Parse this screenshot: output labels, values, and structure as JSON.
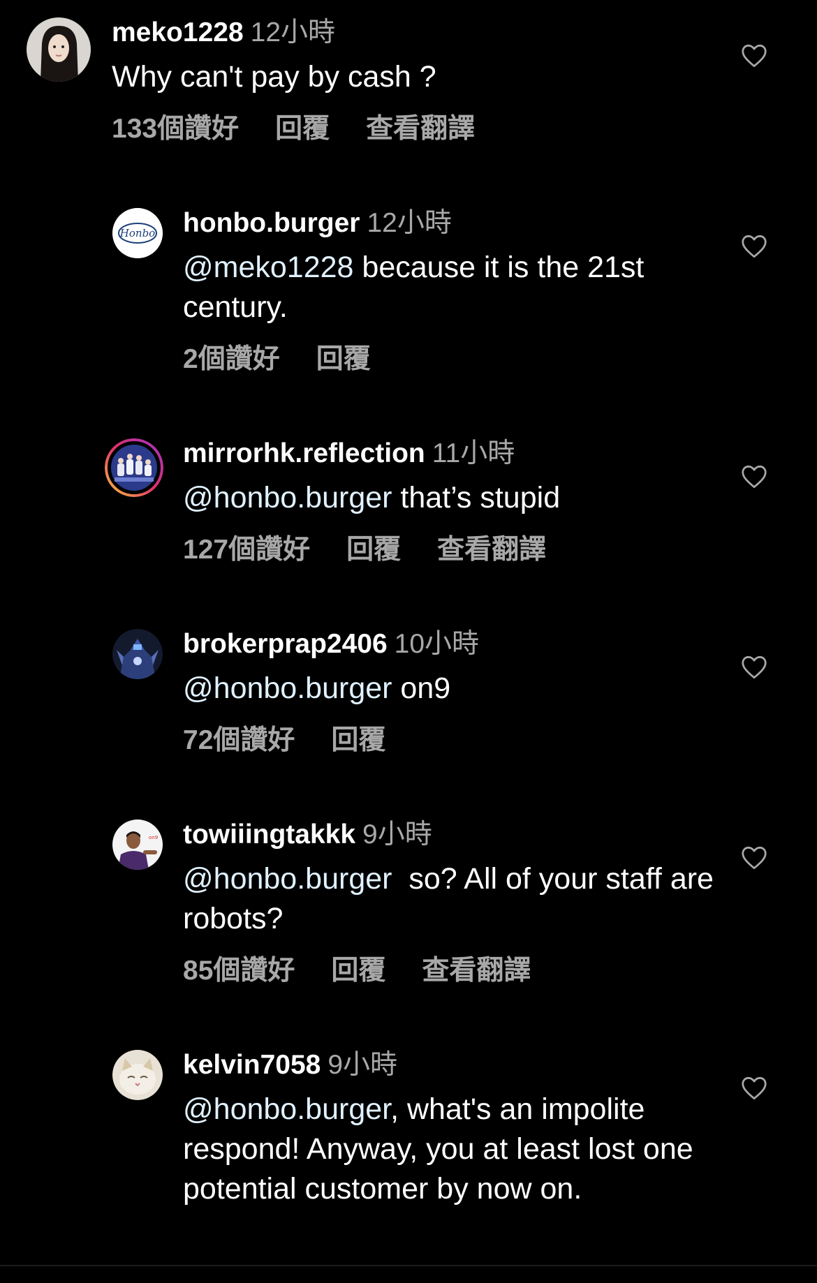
{
  "comments": [
    {
      "username": "meko1228",
      "time": "12小時",
      "mention": "",
      "text": "Why can't pay by cash ?",
      "likes": "133個讚好",
      "reply": "回覆",
      "translate": "查看翻譯",
      "avatar_icon": "woman-portrait-avatar"
    },
    {
      "username": "honbo.burger",
      "time": "12小時",
      "mention": "@meko1228",
      "text": " because it is the 21st century.",
      "likes": "2個讚好",
      "reply": "回覆",
      "translate": "",
      "avatar_icon": "honbo-logo-avatar",
      "logo_text": "Honbo"
    },
    {
      "username": "mirrorhk.reflection",
      "time": "11小時",
      "mention": "@honbo.burger",
      "text": " that’s stupid",
      "likes": "127個讚好",
      "reply": "回覆",
      "translate": "查看翻譯",
      "avatar_icon": "group-stage-avatar"
    },
    {
      "username": "brokerprap2406",
      "time": "10小時",
      "mention": "@honbo.burger",
      "text": " on9",
      "likes": "72個讚好",
      "reply": "回覆",
      "translate": "",
      "avatar_icon": "robot-avatar"
    },
    {
      "username": "towiiingtakkk",
      "time": "9小時",
      "mention": "@honbo.burger",
      "text": "  so? All of your staff are robots?",
      "likes": "85個讚好",
      "reply": "回覆",
      "translate": "查看翻譯",
      "avatar_icon": "man-photo-avatar"
    },
    {
      "username": "kelvin7058",
      "time": "9小時",
      "mention": "@honbo.burger",
      "text": ", what's an impolite respond! Anyway, you at least lost one potential customer by now on.",
      "likes": "",
      "reply": "",
      "translate": "",
      "avatar_icon": "cat-avatar"
    }
  ],
  "colors": {
    "background": "#000000",
    "username": "#ffffff",
    "secondary": "#a8a8a8",
    "mention": "#e0f1ff"
  }
}
